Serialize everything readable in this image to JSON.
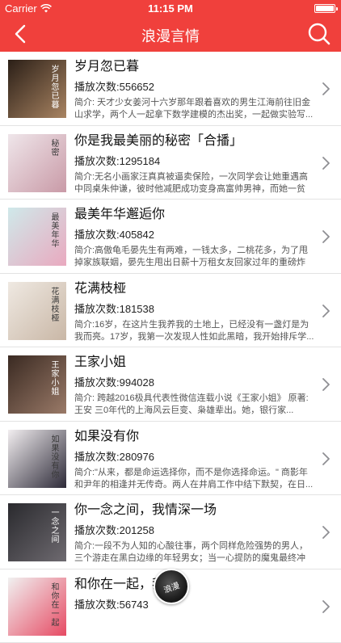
{
  "status": {
    "carrier": "Carrier",
    "time": "11:15 PM"
  },
  "nav": {
    "title": "浪漫言情",
    "back_icon": "chevron-left-icon",
    "search_icon": "search-icon"
  },
  "items": [
    {
      "title": "岁月忽已暮",
      "plays": "播放次数:556652",
      "desc": "简介: 天才少女姜河十六岁那年跟着喜欢的男生江海前往旧金山求学，两个人一起拿下数学建模的杰出奖，一起做实验写...",
      "cover_text": "岁月忽已暮",
      "cover_colors": [
        "#2b1f17",
        "#a98462"
      ]
    },
    {
      "title": "你是我最美丽的秘密「合播」",
      "plays": "播放次数:1295184",
      "desc": "简介:无名小画家汪真真被逼卖保险，一次同学会让她重遇高中同桌朱仲谦，彼时他减肥成功变身高富帅男神，而她一贫如...",
      "cover_text": "秘密",
      "cover_colors": [
        "#efe6ea",
        "#c99aa7"
      ]
    },
    {
      "title": "最美年华邂逅你",
      "plays": "播放次数:405842",
      "desc": "简介:高傲龟毛晏先生有两难，一钱太多，二桃花多，为了甩掉家族联姻，晏先生甩出日薪十万租女友回家过年的重磅炸弹...",
      "cover_text": "最美年华",
      "cover_colors": [
        "#cfe9ea",
        "#e9a9bf"
      ]
    },
    {
      "title": "花满枝桠",
      "plays": "播放次数:181538",
      "desc": "简介:16岁，在这片生我养我的土地上，已经没有一盏灯是为我而亮。17岁，我第一次发现人性如此黑暗，我开始排斥学...",
      "cover_text": "花满枝桠",
      "cover_colors": [
        "#efe9e2",
        "#c9b7a6"
      ]
    },
    {
      "title": "王家小姐",
      "plays": "播放次数:994028",
      "desc": "简介: 跨越2016极具代表性微信连载小说《王家小姐》 原著: 王安 三0年代的上海风云巨变、枭雄辈出。她，银行家...",
      "cover_text": "王家小姐",
      "cover_colors": [
        "#3a2a22",
        "#9a7a68"
      ]
    },
    {
      "title": "如果没有你",
      "plays": "播放次数:280976",
      "desc": "简介:\"从来，都是命运选择你，而不是你选择命运。\" 商影年和尹年的相逢并无传奇。两人在井肩工作中结下默契，在日...",
      "cover_text": "如果没有你",
      "cover_colors": [
        "#f2eef0",
        "#2d2a38"
      ]
    },
    {
      "title": "你一念之间，我情深一场",
      "plays": "播放次数:201258",
      "desc": "简介:一段不为人知的心酸往事，两个同样危险强势的男人，三个游走在黑白边缘的年轻男女；当一心提防的魔鬼最终冲破...",
      "cover_text": "一念之间",
      "cover_colors": [
        "#2a2a2e",
        "#6e6a70"
      ]
    },
    {
      "title": "和你在一起，我",
      "plays": "播放次数:56743",
      "desc": "",
      "cover_text": "和你在一起",
      "cover_colors": [
        "#f1f1f1",
        "#e64a63"
      ]
    }
  ],
  "chevron_icon": "chevron-right-icon",
  "floating_button": {
    "label": "浪漫",
    "icon": "app-logo-icon"
  }
}
